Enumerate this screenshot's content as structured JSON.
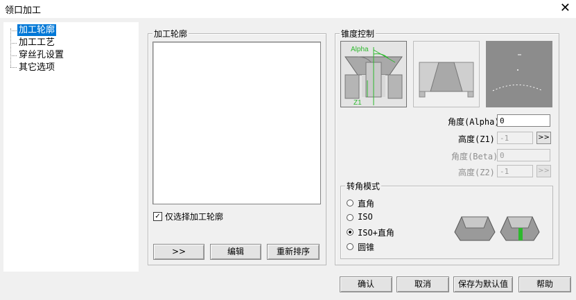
{
  "window": {
    "title": "领口加工",
    "close_glyph": "✕"
  },
  "tree": {
    "items": [
      {
        "label": "加工轮廓",
        "selected": true
      },
      {
        "label": "加工工艺",
        "selected": false
      },
      {
        "label": "穿丝孔设置",
        "selected": false
      },
      {
        "label": "其它选项",
        "selected": false
      }
    ]
  },
  "profile": {
    "group_label": "加工轮廓",
    "only_select_label": "仅选择加工轮廓",
    "only_select_checked": true,
    "buttons": {
      "move": ">>",
      "edit": "编辑",
      "reorder": "重新排序"
    }
  },
  "taper": {
    "group_label": "锥度控制",
    "diagram_labels": {
      "alpha": "Alpha",
      "z1": "Z1"
    },
    "alpha_label": "角度(Alpha)",
    "alpha_value": "0",
    "z1_label": "高度(Z1)",
    "z1_value": "-1",
    "beta_label": "角度(Beta)",
    "beta_value": "0",
    "z2_label": "高度(Z2)",
    "z2_value": "-1",
    "more": ">>"
  },
  "corner": {
    "group_label": "转角模式",
    "options": [
      {
        "label": "直角",
        "selected": false
      },
      {
        "label": "ISO",
        "selected": false
      },
      {
        "label": "ISO+直角",
        "selected": true
      },
      {
        "label": "圆锥",
        "selected": false
      }
    ]
  },
  "footer": {
    "ok": "确认",
    "cancel": "取消",
    "save_default": "保存为默认值",
    "help": "帮助"
  },
  "colors": {
    "selection": "#0078d7",
    "highlight_green": "#2db82d"
  }
}
